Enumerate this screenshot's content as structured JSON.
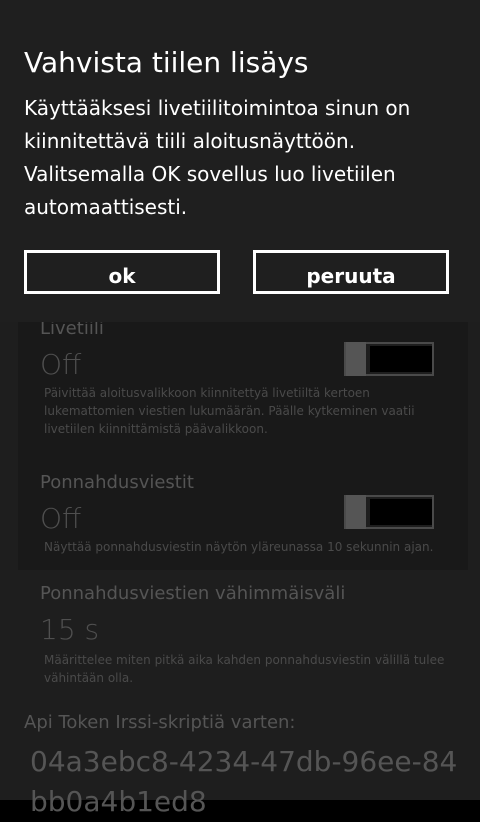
{
  "dialog": {
    "title": "Vahvista tiilen lisäys",
    "message": "Käyttääksesi livetiilitoimintoa sinun on kiinnitettävä tiili aloitusnäyttöön. Valitsemalla OK sovellus luo livetiilen automaattisesti.",
    "ok_label": "ok",
    "cancel_label": "peruuta"
  },
  "settings": {
    "live_tile": {
      "label": "Livetiili",
      "value": "Off",
      "enabled": false,
      "description": "Päivittää aloitusvalikkoon kiinnitettyä livetiiltä kertoen lukemattomien viestien lukumäärän. Päälle kytkeminen vaatii livetiilen kiinnittämistä päävalikkoon."
    },
    "popups": {
      "label": "Ponnahdusviestit",
      "value": "Off",
      "enabled": false,
      "description": "Näyttää ponnahdusviestin näytön yläreunassa 10 sekunnin ajan."
    },
    "popup_interval": {
      "label": "Ponnahdusviestien vähimmäisväli",
      "value": "15 s",
      "description": "Määrittelee miten pitkä aika kahden ponnahdusviestin välillä tulee vähintään olla."
    },
    "api_token": {
      "label": "Api Token Irssi-skriptiä varten:",
      "value": "04a3ebc8-4234-47db-96ee-84bb0a4b1ed8"
    }
  }
}
